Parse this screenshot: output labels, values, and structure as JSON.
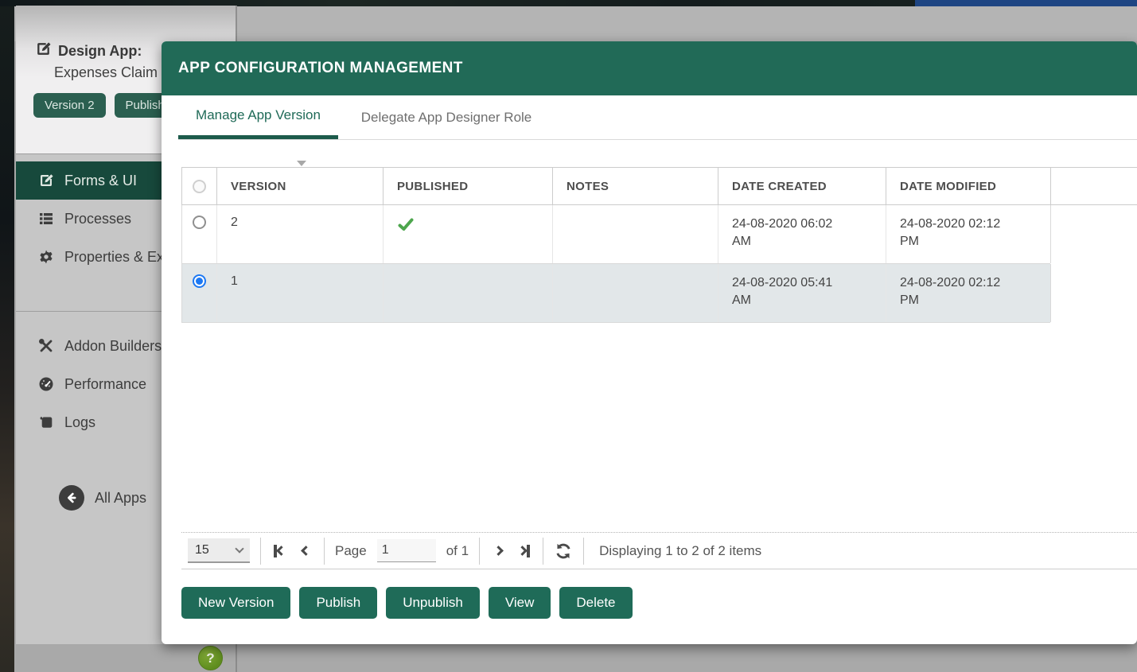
{
  "sidebar": {
    "design_app_label": "Design App:",
    "app_name": "Expenses Claim",
    "badges": [
      {
        "label": "Version 2"
      },
      {
        "label": "Publish"
      }
    ],
    "menu": [
      {
        "label": "Forms & UI",
        "icon": "pencil-square-icon",
        "active": true
      },
      {
        "label": "Processes",
        "icon": "list-icon",
        "active": false
      },
      {
        "label": "Properties & Ex",
        "icon": "gear-icon",
        "active": false
      }
    ],
    "tools_menu": [
      {
        "label": "Addon Builders",
        "icon": "tools-icon"
      },
      {
        "label": "Performance",
        "icon": "speedometer-icon"
      },
      {
        "label": "Logs",
        "icon": "scroll-icon"
      }
    ],
    "all_apps_label": "All Apps"
  },
  "modal": {
    "title": "APP CONFIGURATION MANAGEMENT",
    "tabs": [
      {
        "label": "Manage App Version",
        "active": true
      },
      {
        "label": "Delegate App Designer Role",
        "active": false
      }
    ],
    "table": {
      "columns": [
        "VERSION",
        "PUBLISHED",
        "NOTES",
        "DATE CREATED",
        "DATE MODIFIED"
      ],
      "sorted_column": "VERSION",
      "rows": [
        {
          "version": "2",
          "published": true,
          "notes": "",
          "date_created": "24-08-2020 06:02 AM",
          "date_modified": "24-08-2020 02:12 PM",
          "selected": false
        },
        {
          "version": "1",
          "published": false,
          "notes": "",
          "date_created": "24-08-2020 05:41 AM",
          "date_modified": "24-08-2020 02:12 PM",
          "selected": true
        }
      ]
    },
    "pager": {
      "page_size": "15",
      "page_label": "Page",
      "page_value": "1",
      "of_label": "of 1",
      "status": "Displaying 1 to 2 of 2 items"
    },
    "buttons": [
      {
        "label": "New Version"
      },
      {
        "label": "Publish"
      },
      {
        "label": "Unpublish"
      },
      {
        "label": "View"
      },
      {
        "label": "Delete"
      }
    ]
  },
  "help_label": "?",
  "colors": {
    "modal_header": "#216a57",
    "button_teal": "#1f6b58",
    "badge_teal": "#2b5f50",
    "active_menu_green": "#17493c",
    "tab_active": "#1f6a57",
    "selected_row": "#e2e7e9",
    "radio_blue": "#1d79f3",
    "check_green": "#4da64d",
    "help_green": "#6b9424",
    "overlay_gray": "#b4b4b4"
  }
}
